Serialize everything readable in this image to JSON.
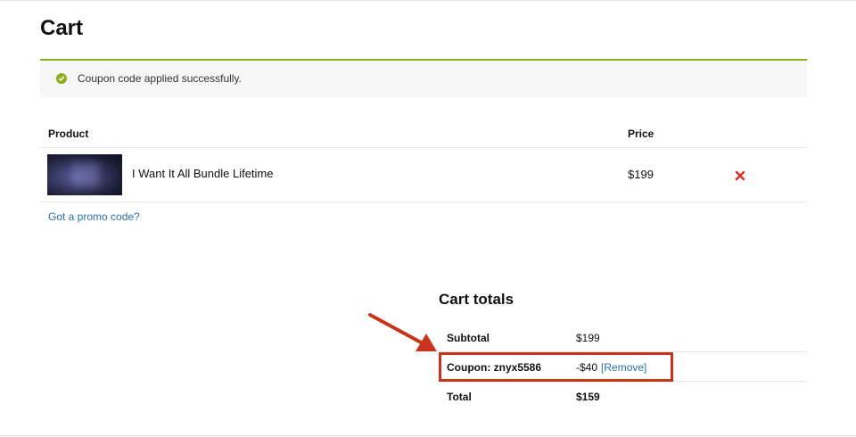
{
  "page": {
    "title": "Cart"
  },
  "notice": {
    "text": "Coupon code applied successfully."
  },
  "cart_table": {
    "headers": {
      "product": "Product",
      "price": "Price"
    },
    "items": [
      {
        "name": "I Want It All Bundle Lifetime",
        "price": "$199"
      }
    ]
  },
  "promo": {
    "link_text": "Got a promo code?"
  },
  "totals": {
    "title": "Cart totals",
    "subtotal": {
      "label": "Subtotal",
      "value": "$199"
    },
    "coupon": {
      "label": "Coupon: znyx5586",
      "value": "-$40",
      "remove_text": "[Remove]"
    },
    "total": {
      "label": "Total",
      "value": "$159"
    }
  },
  "colors": {
    "success": "#8fae1b",
    "link": "#2a6fa8",
    "remove": "#d9342b",
    "annotation": "#c8341c"
  }
}
